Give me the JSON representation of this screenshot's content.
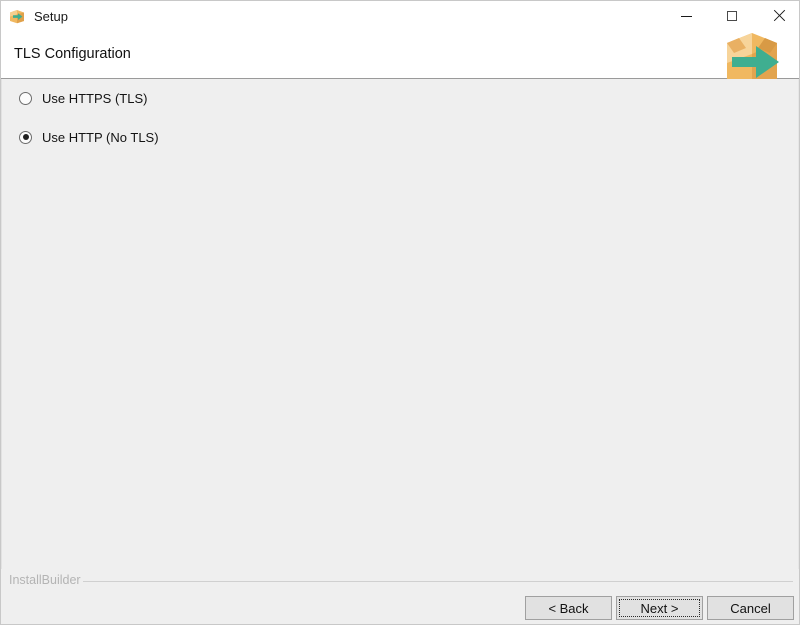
{
  "window": {
    "title": "Setup",
    "app_icon": "installer-box-arrow-icon",
    "controls": {
      "minimize": "minimize-icon",
      "maximize": "maximize-icon",
      "close": "close-icon"
    }
  },
  "header": {
    "page_title": "TLS Configuration",
    "logo": "installbuilder-box-arrow-logo"
  },
  "main": {
    "options": [
      {
        "label": "Use HTTPS (TLS)",
        "selected": false,
        "name": "radio-use-https-tls"
      },
      {
        "label": "Use HTTP (No TLS)",
        "selected": true,
        "name": "radio-use-http-no-tls"
      }
    ]
  },
  "footer": {
    "brand": "InstallBuilder",
    "buttons": {
      "back": "< Back",
      "next": "Next >",
      "cancel": "Cancel"
    },
    "focused_button": "next"
  },
  "colors": {
    "window_background": "#efefef",
    "header_background": "#ffffff",
    "separator": "#9a9a9a",
    "button_face": "#e1e1e1",
    "button_border": "#a0a0a0",
    "brand_text": "#b4b4b4",
    "logo_box": "#f0b860",
    "logo_arrow": "#3fae90",
    "text": "#111111"
  }
}
